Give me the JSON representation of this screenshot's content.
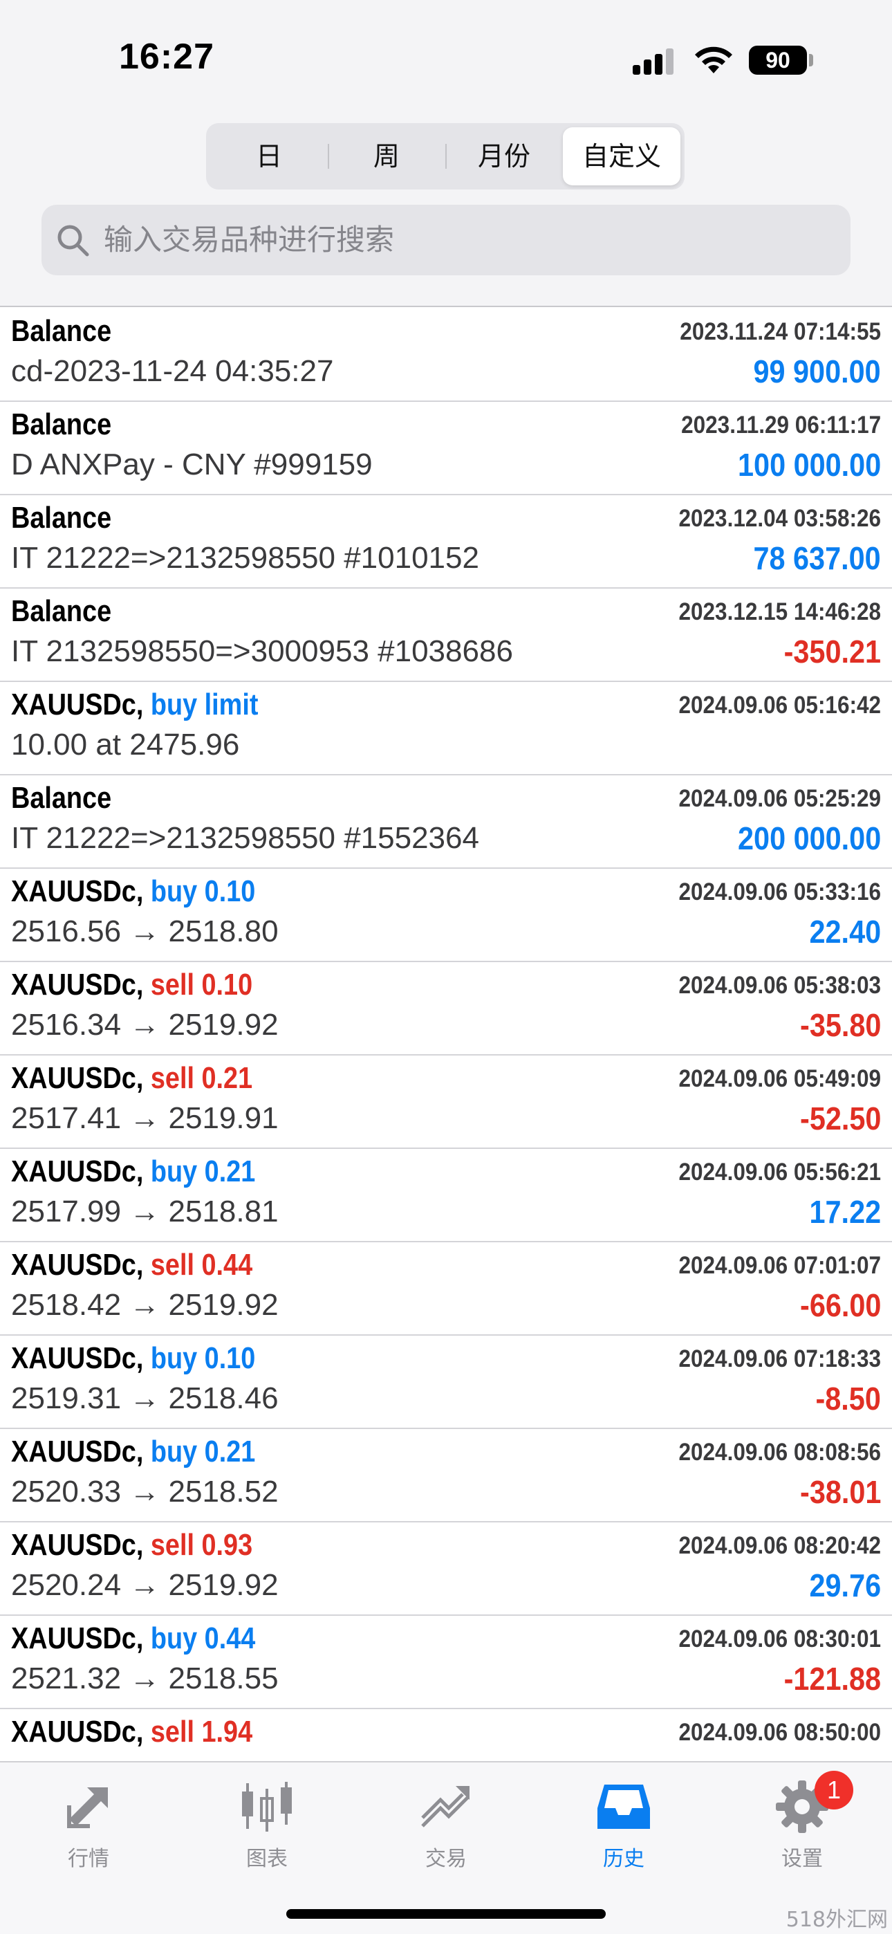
{
  "status_bar": {
    "time": "16:27",
    "battery": "90"
  },
  "segments": [
    "日",
    "周",
    "月份",
    "自定义"
  ],
  "search": {
    "placeholder": "输入交易品种进行搜索"
  },
  "rows": [
    {
      "title": "Balance",
      "action": "",
      "sub": "cd-2023-11-24 04:35:27",
      "time": "2023.11.24 07:14:55",
      "amount": "99 900.00",
      "color": "#0a7ef0"
    },
    {
      "title": "Balance",
      "action": "",
      "sub": "D ANXPay - CNY #999159",
      "time": "2023.11.29 06:11:17",
      "amount": "100 000.00",
      "color": "#0a7ef0"
    },
    {
      "title": "Balance",
      "action": "",
      "sub": "IT 21222=>2132598550 #1010152",
      "time": "2023.12.04 03:58:26",
      "amount": "78 637.00",
      "color": "#0a7ef0"
    },
    {
      "title": "Balance",
      "action": "",
      "sub": "IT 2132598550=>3000953 #1038686",
      "time": "2023.12.15 14:46:28",
      "amount": "-350.21",
      "color": "#e02f24"
    },
    {
      "title": "XAUUSDc,",
      "action": "buy limit",
      "action_color": "#0a7ef0",
      "sub": "10.00 at 2475.96",
      "time": "2024.09.06 05:16:42",
      "amount": "",
      "color": "#0a7ef0"
    },
    {
      "title": "Balance",
      "action": "",
      "sub": "IT 21222=>2132598550 #1552364",
      "time": "2024.09.06 05:25:29",
      "amount": "200 000.00",
      "color": "#0a7ef0"
    },
    {
      "title": "XAUUSDc,",
      "action": "buy 0.10",
      "action_color": "#0a7ef0",
      "sub": "2516.56 → 2518.80",
      "time": "2024.09.06 05:33:16",
      "amount": "22.40",
      "color": "#0a7ef0"
    },
    {
      "title": "XAUUSDc,",
      "action": "sell 0.10",
      "action_color": "#e02f24",
      "sub": "2516.34 → 2519.92",
      "time": "2024.09.06 05:38:03",
      "amount": "-35.80",
      "color": "#e02f24"
    },
    {
      "title": "XAUUSDc,",
      "action": "sell 0.21",
      "action_color": "#e02f24",
      "sub": "2517.41 → 2519.91",
      "time": "2024.09.06 05:49:09",
      "amount": "-52.50",
      "color": "#e02f24"
    },
    {
      "title": "XAUUSDc,",
      "action": "buy 0.21",
      "action_color": "#0a7ef0",
      "sub": "2517.99 → 2518.81",
      "time": "2024.09.06 05:56:21",
      "amount": "17.22",
      "color": "#0a7ef0"
    },
    {
      "title": "XAUUSDc,",
      "action": "sell 0.44",
      "action_color": "#e02f24",
      "sub": "2518.42 → 2519.92",
      "time": "2024.09.06 07:01:07",
      "amount": "-66.00",
      "color": "#e02f24"
    },
    {
      "title": "XAUUSDc,",
      "action": "buy 0.10",
      "action_color": "#0a7ef0",
      "sub": "2519.31 → 2518.46",
      "time": "2024.09.06 07:18:33",
      "amount": "-8.50",
      "color": "#e02f24"
    },
    {
      "title": "XAUUSDc,",
      "action": "buy 0.21",
      "action_color": "#0a7ef0",
      "sub": "2520.33 → 2518.52",
      "time": "2024.09.06 08:08:56",
      "amount": "-38.01",
      "color": "#e02f24"
    },
    {
      "title": "XAUUSDc,",
      "action": "sell 0.93",
      "action_color": "#e02f24",
      "sub": "2520.24 → 2519.92",
      "time": "2024.09.06 08:20:42",
      "amount": "29.76",
      "color": "#0a7ef0"
    },
    {
      "title": "XAUUSDc,",
      "action": "buy 0.44",
      "action_color": "#0a7ef0",
      "sub": "2521.32 → 2518.55",
      "time": "2024.09.06 08:30:01",
      "amount": "-121.88",
      "color": "#e02f24"
    },
    {
      "title": "XAUUSDc,",
      "action": "sell 1.94",
      "action_color": "#e02f24",
      "sub": "",
      "time": "2024.09.06 08:50:00",
      "amount": "",
      "color": "#e02f24"
    }
  ],
  "tabs": [
    {
      "label": "行情",
      "icon": "quotes-arrows-icon"
    },
    {
      "label": "图表",
      "icon": "candlestick-chart-icon"
    },
    {
      "label": "交易",
      "icon": "trade-chart-icon"
    },
    {
      "label": "历史",
      "icon": "history-tray-icon"
    },
    {
      "label": "设置",
      "icon": "gear-icon",
      "badge": "1"
    }
  ],
  "watermark": "518外汇网",
  "colors": {
    "accent": "#0a7ef0",
    "loss": "#e02f24",
    "inactive": "#8e8e93"
  }
}
